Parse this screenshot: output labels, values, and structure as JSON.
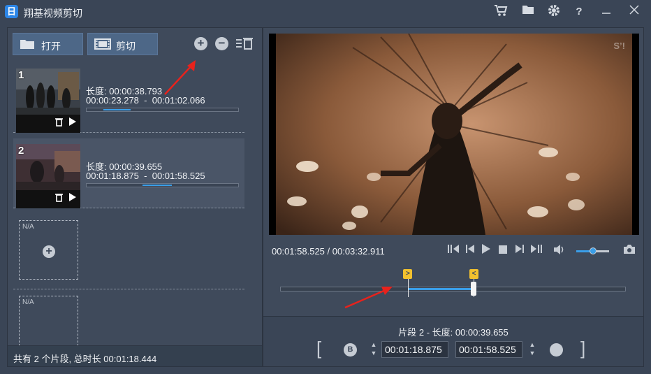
{
  "app": {
    "title": "翔基视频剪切",
    "logo_char": "日"
  },
  "titlebar": {
    "icons": [
      "cart-icon",
      "folder-icon",
      "gear-icon",
      "help-icon",
      "minimize-icon",
      "close-icon"
    ],
    "help_glyph": "?"
  },
  "toolbar": {
    "open_label": "打开",
    "cut_label": "剪切"
  },
  "clips": [
    {
      "index": "1",
      "length_label": "长度: 00:00:38.793",
      "start": "00:00:23.278",
      "end": "00:01:02.066",
      "range_sep": "-",
      "progress_start": 0.11,
      "progress_end": 0.29
    },
    {
      "index": "2",
      "length_label": "长度: 00:00:39.655",
      "start": "00:01:18.875",
      "end": "00:01:58.525",
      "range_sep": "-",
      "progress_start": 0.37,
      "progress_end": 0.56
    }
  ],
  "empty_slots": [
    {
      "label": "N/A"
    },
    {
      "label": "N/A"
    }
  ],
  "summary": "共有 2 个片段, 总时长 00:01:18.444",
  "player": {
    "current_time": "00:01:58.525",
    "total_time": "00:03:32.911",
    "time_sep": " / ",
    "volume": 0.5,
    "watermark": "S’!"
  },
  "timeline": {
    "selection_start_fraction": 0.37,
    "selection_end_fraction": 0.56,
    "start_flag": ">",
    "end_flag": "<"
  },
  "segment": {
    "info": "片段 2 - 长度: 00:00:39.655",
    "start_value": "00:01:18.875",
    "end_value": "00:01:58.525",
    "b_label": "B",
    "bracket_open": "[",
    "bracket_close": "]"
  },
  "colors": {
    "accent": "#3a9ee8",
    "marker": "#f2c12e",
    "arrow": "#e8221c"
  }
}
